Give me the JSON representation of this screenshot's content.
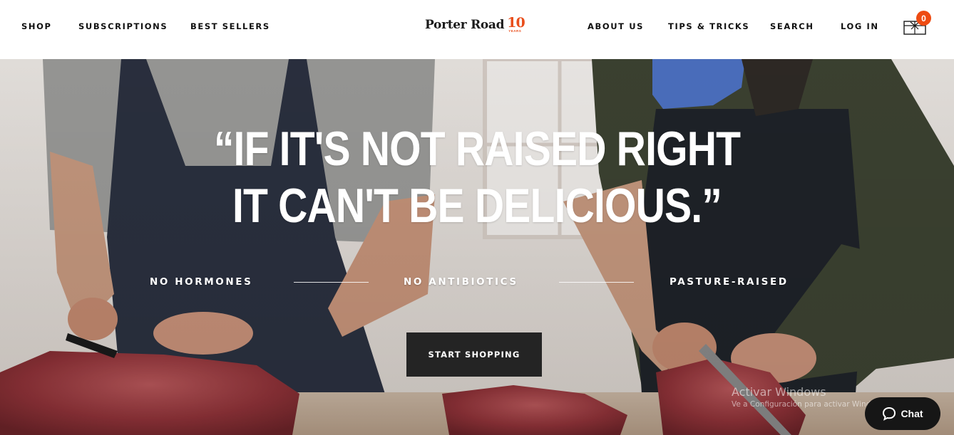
{
  "nav": {
    "left": [
      {
        "label": "SHOP"
      },
      {
        "label": "SUBSCRIPTIONS"
      },
      {
        "label": "BEST SELLERS"
      }
    ],
    "right": [
      {
        "label": "ABOUT US"
      },
      {
        "label": "TIPS & TRICKS"
      },
      {
        "label": "SEARCH"
      },
      {
        "label": "LOG IN"
      }
    ],
    "logo": {
      "text": "Porter Road",
      "anniversary": "10",
      "anniversary_sub": "YEARS"
    },
    "cart": {
      "count": "0",
      "icon": "gift-box-icon",
      "badge_color": "#ee4b12"
    }
  },
  "hero": {
    "quote_line1": "“IF IT'S NOT RAISED RIGHT",
    "quote_line2": "IT CAN'T BE DELICIOUS.”",
    "features": [
      "NO HORMONES",
      "NO ANTIBIOTICS",
      "PASTURE-RAISED"
    ],
    "cta_label": "START SHOPPING"
  },
  "os_watermark": {
    "line1": "Activar Windows",
    "line2": "Ve a Configuración para activar Windows"
  },
  "chat": {
    "label": "Chat",
    "icon": "chat-bubble-icon"
  }
}
